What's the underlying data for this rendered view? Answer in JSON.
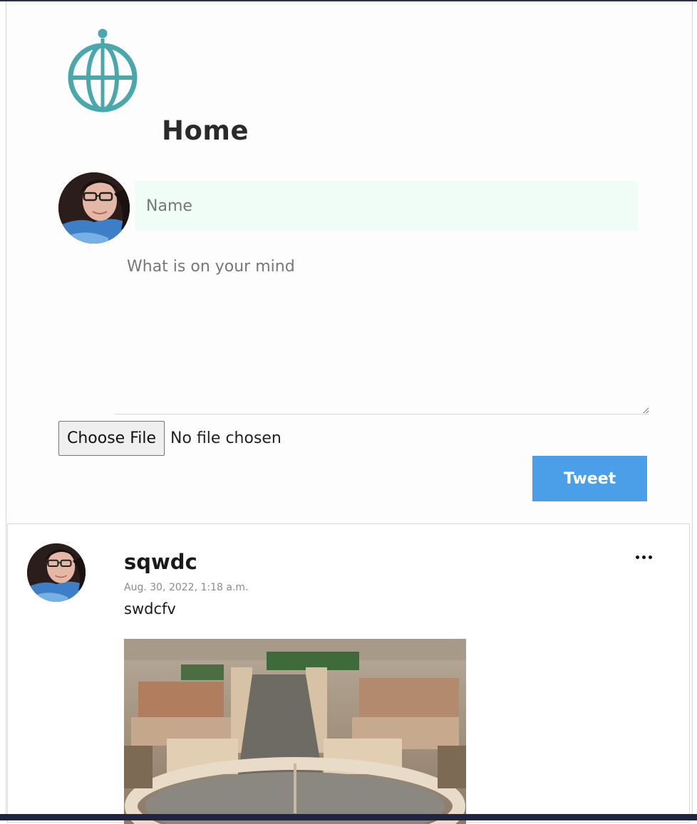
{
  "page": {
    "title": "Home"
  },
  "composer": {
    "name_placeholder": "Name",
    "body_placeholder": "What is on your mind",
    "file_button_label": "Choose File",
    "file_status": "No file chosen",
    "submit_label": "Tweet"
  },
  "posts": [
    {
      "username": "sqwdc",
      "timestamp": "Aug. 30, 2022, 1:18 a.m.",
      "text": "swdcfv",
      "menu_icon": "more-horizontal-icon"
    }
  ],
  "colors": {
    "brand_teal": "#4aa8ad",
    "name_input_bg": "#effdf6",
    "tweet_button_bg": "#4a9fe8",
    "top_edge": "#2b2f4a"
  }
}
